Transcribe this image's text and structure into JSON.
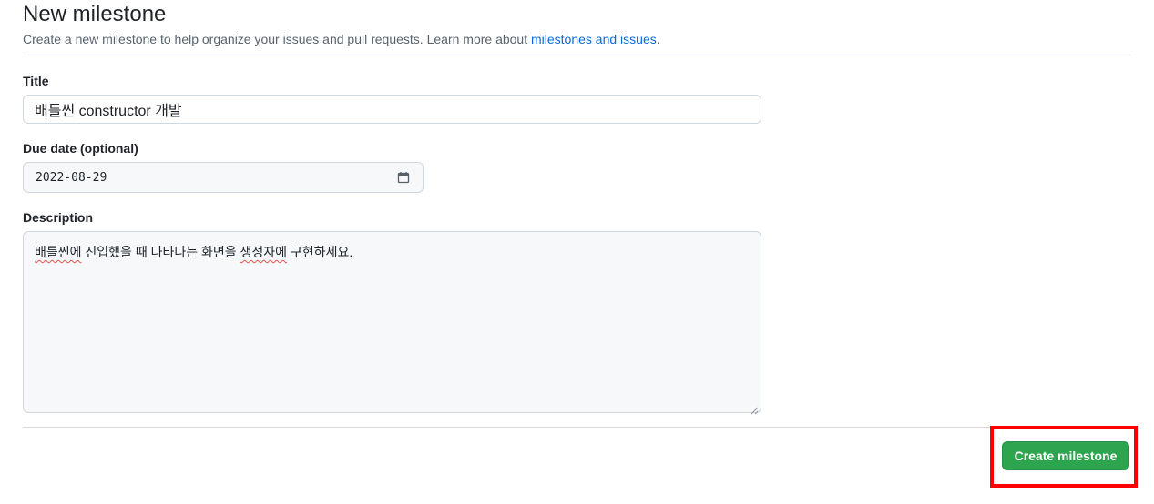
{
  "header": {
    "title": "New milestone",
    "subtitle_prefix": "Create a new milestone to help organize your issues and pull requests. Learn more about ",
    "subtitle_link": "milestones and issues",
    "subtitle_suffix": "."
  },
  "form": {
    "title_label": "Title",
    "title_value": "배틀씬 constructor 개발",
    "due_label": "Due date (optional)",
    "due_value": "2022-08-29",
    "description_label": "Description",
    "description": {
      "parts": [
        {
          "text": "배틀씬에",
          "misspelled": true
        },
        {
          "text": " 진입했을 때 나타나는 화면을 ",
          "misspelled": false
        },
        {
          "text": "생성자에",
          "misspelled": true
        },
        {
          "text": " 구현하세요.",
          "misspelled": false
        }
      ]
    }
  },
  "actions": {
    "create_label": "Create milestone"
  },
  "colors": {
    "primary_button": "#2da44e",
    "link": "#0969da",
    "highlight": "#ff0000"
  },
  "icons": {
    "date_picker": "calendar-icon",
    "textarea_resize": "resize-handle-icon"
  }
}
